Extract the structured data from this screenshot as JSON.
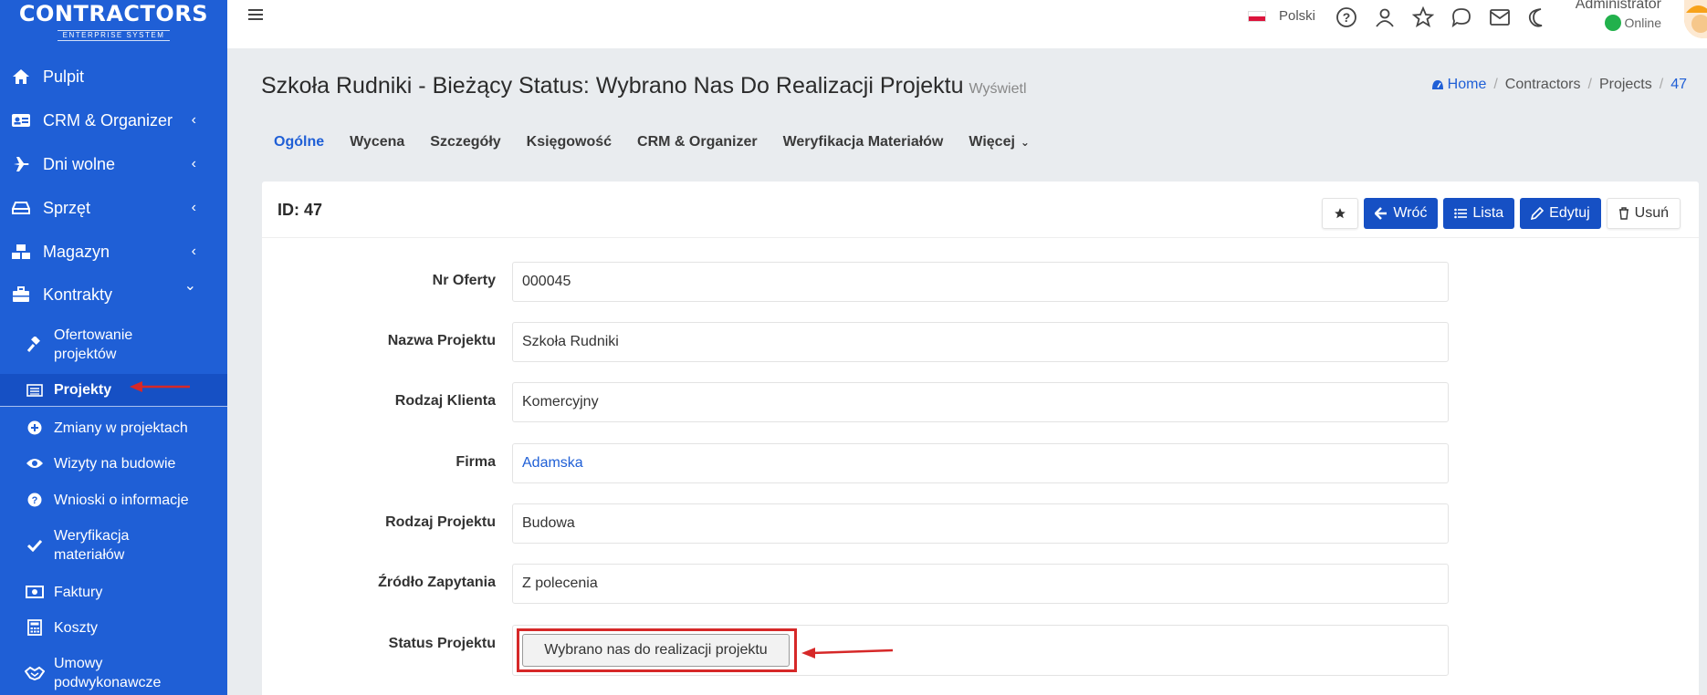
{
  "brand": {
    "name": "CONTRACTORS",
    "tagline": "ENTERPRISE SYSTEM"
  },
  "sidebar": {
    "items": [
      {
        "label": "Pulpit",
        "icon": "home-icon",
        "chevron": ""
      },
      {
        "label": "CRM & Organizer",
        "icon": "id-card-icon",
        "chevron": "‹"
      },
      {
        "label": "Dni wolne",
        "icon": "plane-icon",
        "chevron": "‹"
      },
      {
        "label": "Sprzęt",
        "icon": "hdd-icon",
        "chevron": "‹"
      },
      {
        "label": "Magazyn",
        "icon": "boxes-icon",
        "chevron": "‹"
      },
      {
        "label": "Kontrakty",
        "icon": "briefcase-icon",
        "chevron": "⌄"
      }
    ],
    "subitems": [
      {
        "label": "Ofertowanie\nprojektów",
        "icon": "gavel-icon"
      },
      {
        "label": "Projekty",
        "icon": "list-alt-icon"
      },
      {
        "label": "Zmiany w projektach",
        "icon": "plus-circle-icon"
      },
      {
        "label": "Wizyty na budowie",
        "icon": "eye-icon"
      },
      {
        "label": "Wnioski o informacje",
        "icon": "question-circle-icon"
      },
      {
        "label": "Weryfikacja\nmateriałów",
        "icon": "check-icon"
      },
      {
        "label": "Faktury",
        "icon": "money-bill-icon"
      },
      {
        "label": "Koszty",
        "icon": "calculator-icon"
      },
      {
        "label": "Umowy\npodwykonawcze",
        "icon": "handshake-icon"
      }
    ]
  },
  "topbar": {
    "language": "Polski",
    "user_name": "Administrator",
    "user_status": "Online"
  },
  "header": {
    "title": "Szkoła Rudniki - Bieżący Status: Wybrano Nas Do Realizacji Projektu",
    "subtitle": "Wyświetl",
    "breadcrumb": [
      "Home",
      "Contractors",
      "Projects",
      "47"
    ]
  },
  "tabs": [
    "Ogólne",
    "Wycena",
    "Szczegóły",
    "Księgowość",
    "CRM & Organizer",
    "Weryfikacja Materiałów",
    "Więcej"
  ],
  "card": {
    "id_label": "ID: 47",
    "buttons": {
      "back": "Wróć",
      "list": "Lista",
      "edit": "Edytuj",
      "delete": "Usuń"
    },
    "fields": [
      {
        "label": "Nr Oferty",
        "value": "000045"
      },
      {
        "label": "Nazwa Projektu",
        "value": "Szkoła Rudniki"
      },
      {
        "label": "Rodzaj Klienta",
        "value": "Komercyjny"
      },
      {
        "label": "Firma",
        "value": "Adamska"
      },
      {
        "label": "Rodzaj Projektu",
        "value": "Budowa"
      },
      {
        "label": "Źródło Zapytania",
        "value": "Z polecenia"
      }
    ],
    "status_label": "Status Projektu",
    "status_value": "Wybrano nas do realizacji projektu"
  },
  "colors": {
    "sidebar": "#1f5fd6",
    "primary_button": "#1650c4",
    "annotation": "#d62828"
  }
}
